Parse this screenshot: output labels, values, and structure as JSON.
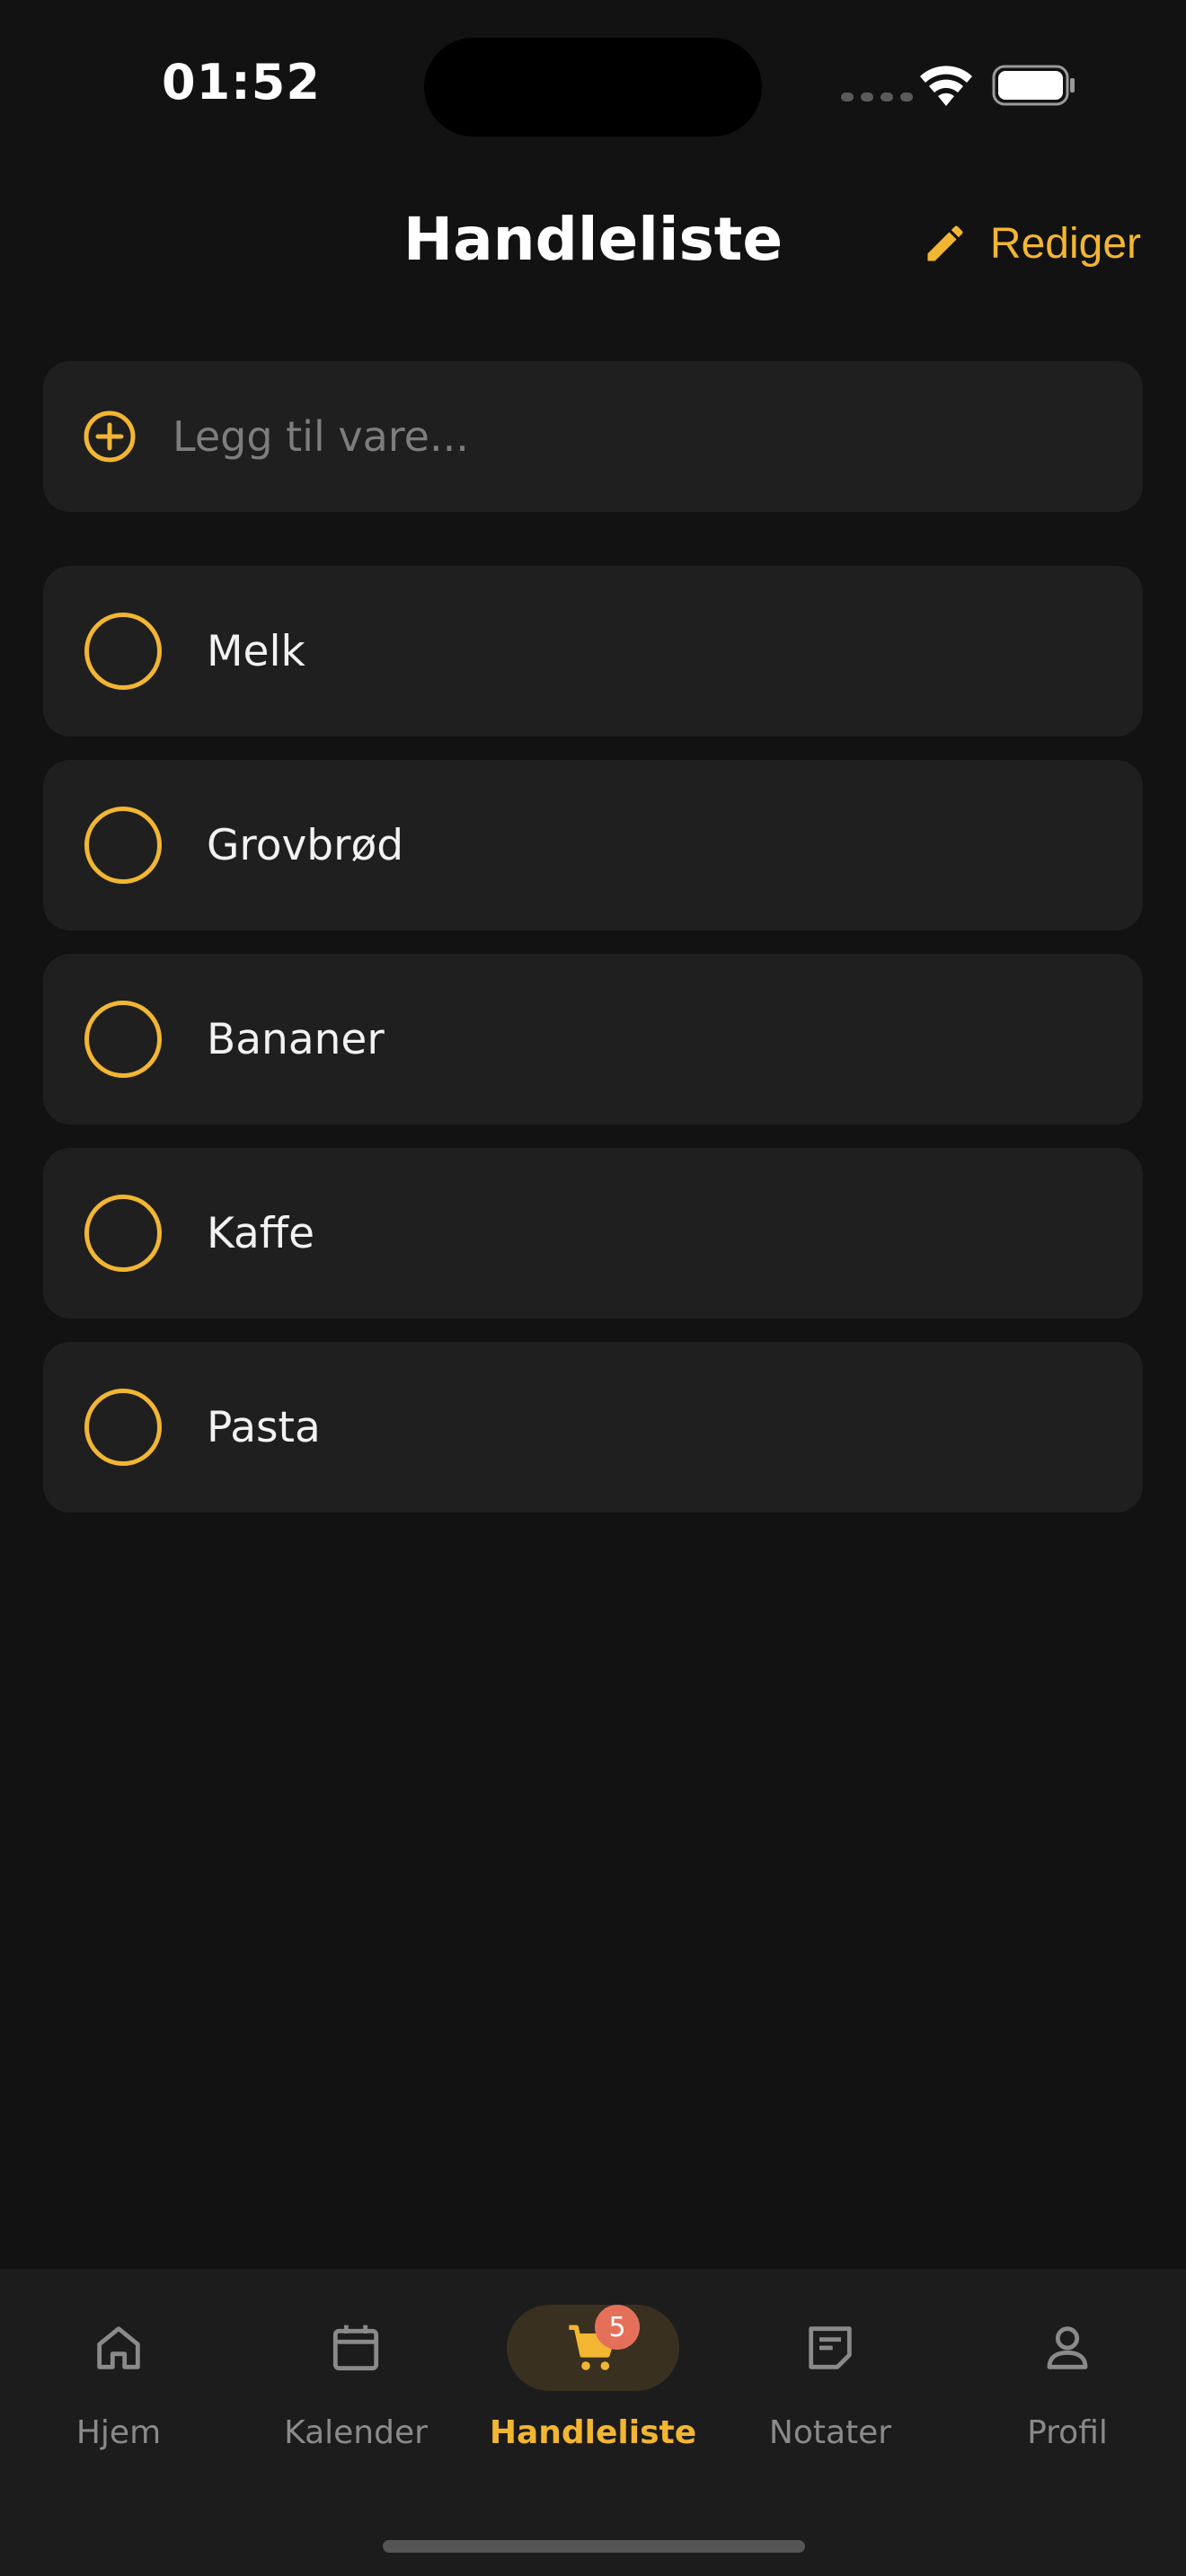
{
  "status_bar": {
    "time": "01:52"
  },
  "header": {
    "title": "Handleliste",
    "edit_label": "Rediger"
  },
  "add_item": {
    "placeholder": "Legg til vare..."
  },
  "items": [
    {
      "label": "Melk",
      "checked": false
    },
    {
      "label": "Grovbrød",
      "checked": false
    },
    {
      "label": "Bananer",
      "checked": false
    },
    {
      "label": "Kaffe",
      "checked": false
    },
    {
      "label": "Pasta",
      "checked": false
    }
  ],
  "tabs": [
    {
      "label": "Hjem",
      "icon": "home-icon"
    },
    {
      "label": "Kalender",
      "icon": "calendar-icon"
    },
    {
      "label": "Handleliste",
      "icon": "cart-icon",
      "active": true,
      "badge": "5"
    },
    {
      "label": "Notater",
      "icon": "note-icon"
    },
    {
      "label": "Profil",
      "icon": "profile-icon"
    }
  ],
  "colors": {
    "background": "#121212",
    "card": "#1f1f1f",
    "accent": "#F2B632",
    "badge": "#E5705A",
    "inactive": "#8a8a8a"
  }
}
